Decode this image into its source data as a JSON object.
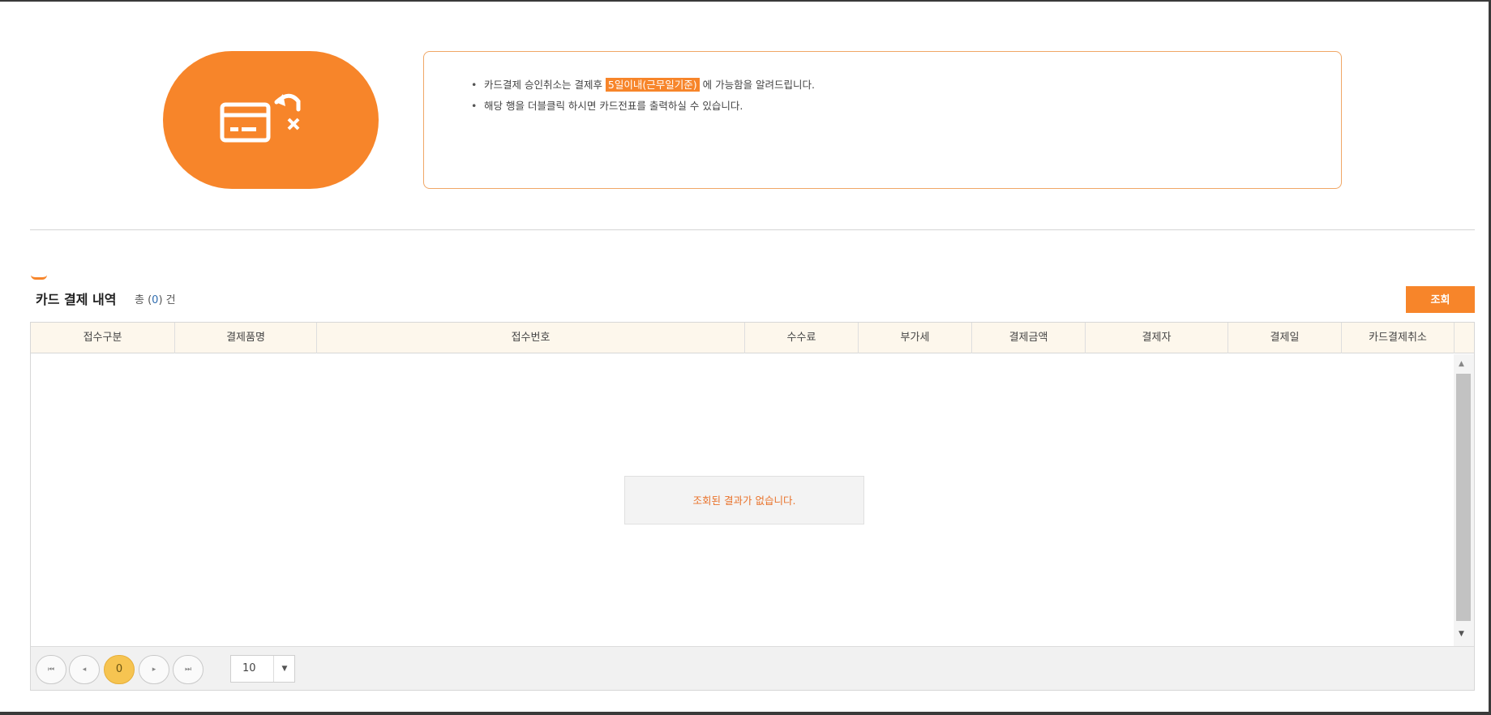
{
  "notice": {
    "line1_before": "카드결제 승인취소는 결제후 ",
    "line1_highlight": "5일이내(근무일기준)",
    "line1_after": " 에 가능함을 알려드립니다.",
    "line2": "해당 행을 더블클릭 하시면 카드전표를 출력하실 수 있습니다."
  },
  "section": {
    "title": "카드 결제 내역",
    "count_prefix": "총 (",
    "count_value": "0",
    "count_suffix": ") 건"
  },
  "toolbar": {
    "search_label": "조회"
  },
  "table": {
    "columns": [
      "접수구분",
      "결제품명",
      "접수번호",
      "수수료",
      "부가세",
      "결제금액",
      "결제자",
      "결제일",
      "카드결제취소"
    ],
    "empty_message": "조회된 결과가 없습니다."
  },
  "pager": {
    "current_page": "0",
    "page_size": "10",
    "first_icon": "⏮",
    "prev_icon": "◂",
    "next_icon": "▸",
    "last_icon": "⏭"
  },
  "colors": {
    "accent": "#f7852a",
    "header_bg": "#fdf7ec",
    "current_page": "#f6c451"
  }
}
